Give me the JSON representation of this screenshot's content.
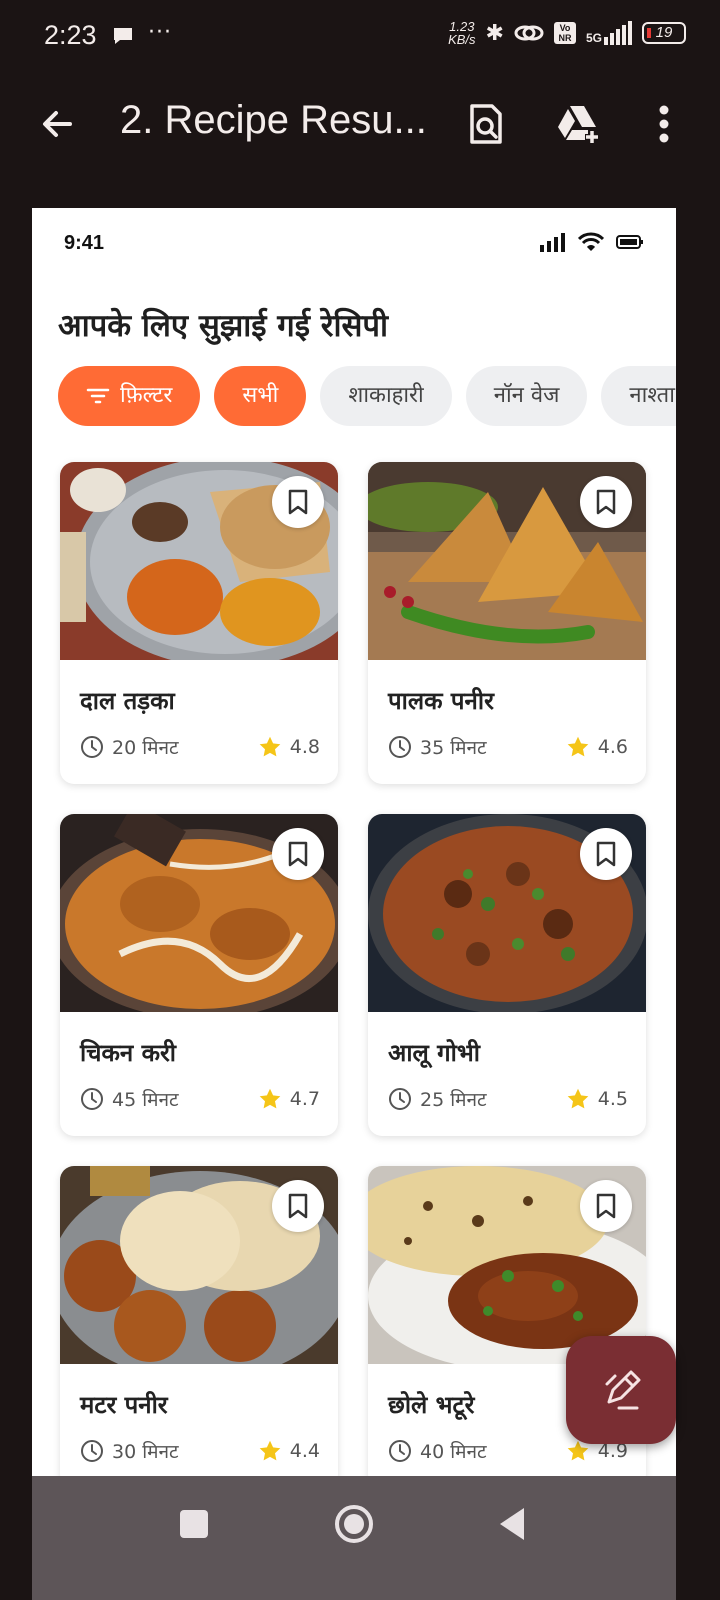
{
  "os_status": {
    "time": "2:23",
    "dots": "···",
    "speed_value": "1.23",
    "speed_unit": "KB/s",
    "volte": "Vo NR",
    "network": "5G",
    "battery": "19"
  },
  "appbar": {
    "title": "2. Recipe Resu..."
  },
  "preview": {
    "time": "9:41",
    "heading": "आपके लिए सुझाई गई रेसिपी",
    "chips": [
      {
        "label": "फ़िल्टर",
        "active": true
      },
      {
        "label": "सभी",
        "active": true
      },
      {
        "label": "शाकाहारी",
        "active": false
      },
      {
        "label": "नॉन वेज",
        "active": false
      },
      {
        "label": "नाश्ता",
        "active": false
      }
    ],
    "recipes": [
      {
        "title": "दाल तड़का",
        "time": "20 मिनट",
        "rating": "4.8"
      },
      {
        "title": "पालक पनीर",
        "time": "35 मिनट",
        "rating": "4.6"
      },
      {
        "title": "चिकन करी",
        "time": "45 मिनट",
        "rating": "4.7"
      },
      {
        "title": "आलू गोभी",
        "time": "25 मिनट",
        "rating": "4.5"
      },
      {
        "title": "मटर पनीर",
        "time": "30 मिनट",
        "rating": "4.4"
      },
      {
        "title": "छोले भटूरे",
        "time": "40 मिनट",
        "rating": "4.9"
      }
    ]
  },
  "colors": {
    "accent": "#ff6b35",
    "fab": "#7a2e33",
    "star": "#f5c518"
  }
}
